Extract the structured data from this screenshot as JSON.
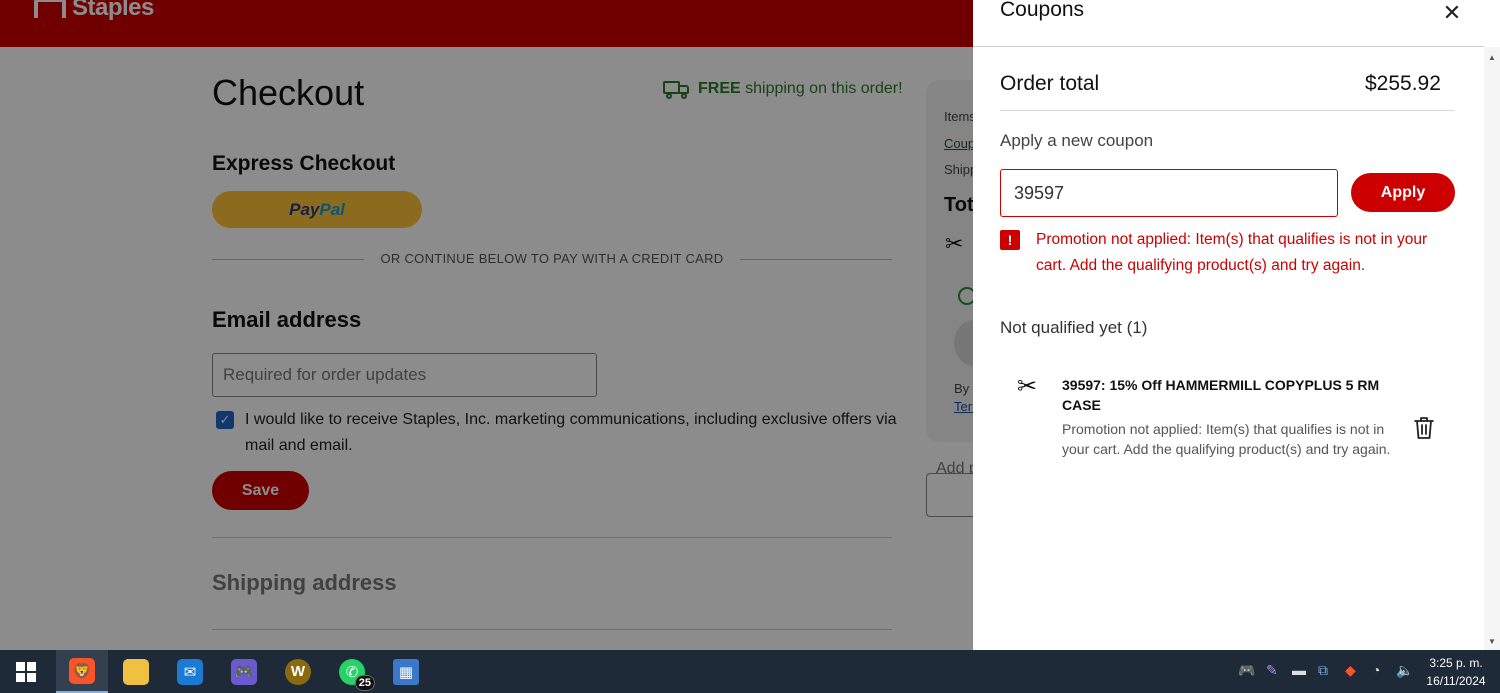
{
  "page": {
    "brand": "Staples",
    "checkout_title": "Checkout",
    "free_shipping_bold": "FREE",
    "free_shipping_rest": "shipping on this order!",
    "express_checkout": "Express Checkout",
    "paypal_pay": "Pay",
    "paypal_pal": "Pal",
    "or_continue": "OR CONTINUE BELOW TO PAY WITH A CREDIT CARD",
    "email_heading": "Email address",
    "email_placeholder": "Required for order updates",
    "marketing_label": "I would like to receive Staples, Inc. marketing communications, including exclusive offers via mail and email.",
    "save_label": "Save",
    "shipping_heading": "Shipping address",
    "summary": {
      "items": "Items",
      "coupon": "Coupons",
      "shipping": "Shipping",
      "total": "Total",
      "by": "By",
      "terms": "Terms",
      "add_promo": "Add p"
    }
  },
  "drawer": {
    "title": "Coupons",
    "order_total_label": "Order total",
    "order_total_value": "$255.92",
    "apply_label": "Apply a new coupon",
    "coupon_value": "39597",
    "apply_button": "Apply",
    "error_message": "Promotion not applied: Item(s) that qualifies is not in your cart. Add the qualifying product(s) and try again.",
    "not_qualified_label": "Not qualified yet (1)",
    "coupon_item": {
      "title": "39597: 15% Off HAMMERMILL COPYPLUS 5 RM CASE",
      "description": "Promotion not applied: Item(s) that qualifies is not in your cart. Add the qualifying product(s) and try again."
    }
  },
  "taskbar": {
    "whatsapp_badge": "25",
    "time": "3:25 p. m.",
    "date": "16/11/2024"
  },
  "colors": {
    "brand_red": "#cc0000",
    "error_red": "#cc0000",
    "paypal_yellow": "#ffc439",
    "checkbox_blue": "#1a66c9",
    "taskbar": "#1f2a38"
  }
}
